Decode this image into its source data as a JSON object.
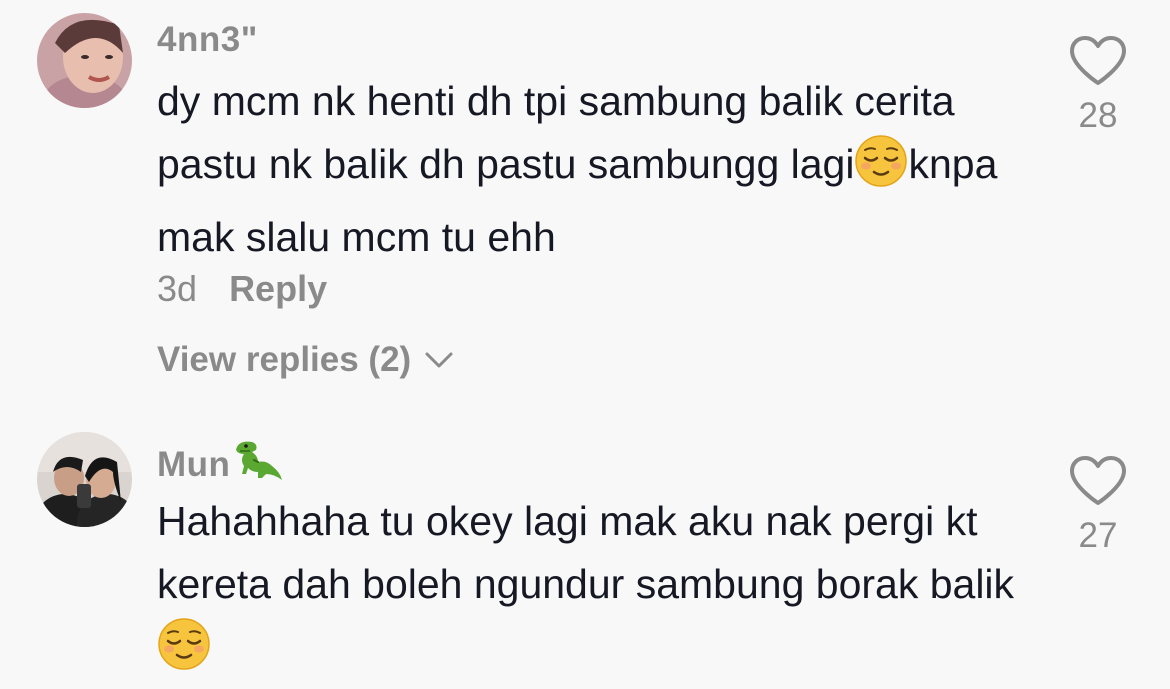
{
  "comments": [
    {
      "username": "4nn3\"",
      "text_parts": [
        "dy mcm nk henti dh tpi sambung balik cerita pastu nk balik dh pastu sambungg lagi",
        "knpa mak slalu mcm tu ehh"
      ],
      "time": "3d",
      "reply_label": "Reply",
      "like_count": "28",
      "view_replies": "View replies (2)"
    },
    {
      "username": "Mun",
      "text_parts": [
        "Hahahhaha tu okey lagi mak aku nak pergi kt kereta dah boleh ngundur sambung borak balik"
      ],
      "like_count": "27"
    }
  ],
  "icons": {
    "like": "heart-outline-icon",
    "expand": "chevron-down-icon",
    "emoji_relieved": "relieved-face-emoji",
    "emoji_dino": "t-rex-emoji"
  },
  "colors": {
    "background": "#f8f8f8",
    "text": "#161823",
    "secondary": "#8a8a8a"
  }
}
